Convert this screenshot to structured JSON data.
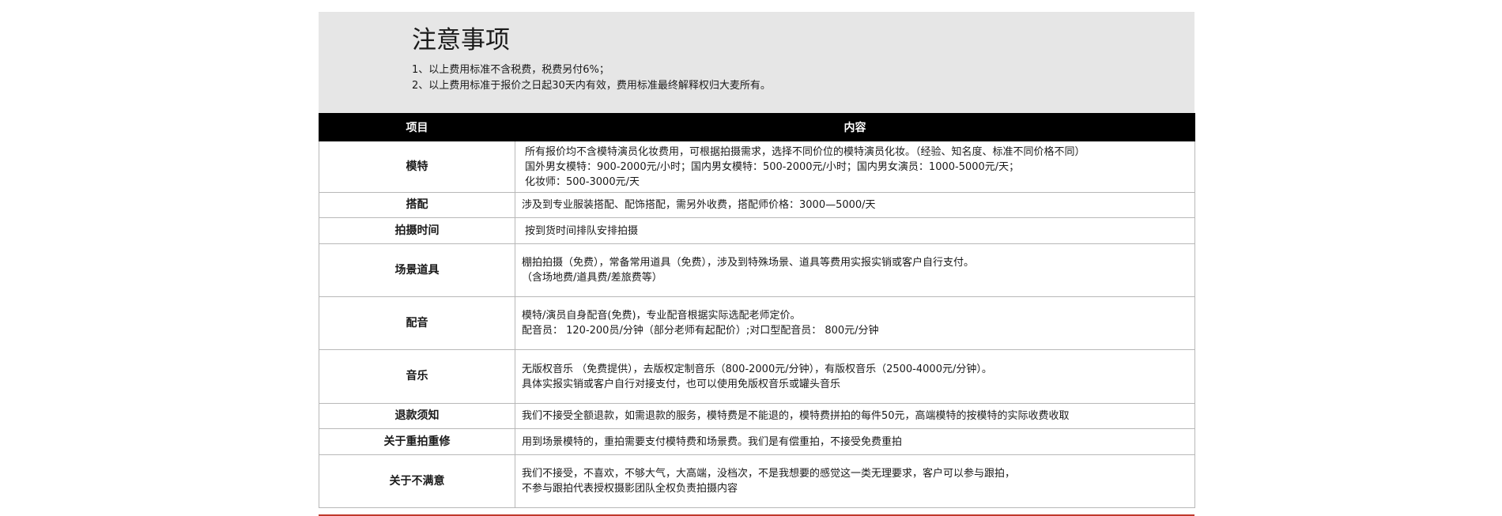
{
  "notice": {
    "title": "注意事项",
    "lines": [
      "1、以上费用标准不含税费，税费另付6%；",
      "2、以上费用标准于报价之日起30天内有效，费用标准最终解释权归大麦所有。"
    ]
  },
  "table": {
    "headers": [
      "项目",
      "内容"
    ],
    "rows": [
      {
        "item": "模特",
        "lines": [
          "所有报价均不含模特演员化妆费用，可根据拍摄需求，选择不同价位的模特演员化妆。（经验、知名度、标准不同价格不同）",
          "国外男女模特：900-2000元/小时；国内男女模特：500-2000元/小时；国内男女演员：1000-5000元/天；",
          "化妆师：500-3000元/天"
        ]
      },
      {
        "item": "搭配",
        "lines": [
          "涉及到专业服装搭配、配饰搭配，需另外收费，搭配师价格：3000—5000/天"
        ]
      },
      {
        "item": "拍摄时间",
        "lines": [
          "按到货时间排队安排拍摄"
        ]
      },
      {
        "item": "场景道具",
        "lines": [
          "棚拍拍摄（免费），常备常用道具（免费），涉及到特殊场景、道具等费用实报实销或客户自行支付。",
          "（含场地费/道具费/差旅费等）"
        ]
      },
      {
        "item": "配音",
        "lines": [
          "模特/演员自身配音(免费)，专业配音根据实际选配老师定价。",
          "配音员： 120-200员/分钟（部分老师有起配价）;对口型配音员： 800元/分钟"
        ]
      },
      {
        "item": "音乐",
        "lines": [
          "无版权音乐 （免费提供），去版权定制音乐（800-2000元/分钟），有版权音乐（2500-4000元/分钟）。",
          "具体实报实销或客户自行对接支付，也可以使用免版权音乐或罐头音乐"
        ]
      },
      {
        "item": "退款须知",
        "lines": [
          "我们不接受全额退款，如需退款的服务，模特费是不能退的，模特费拼拍的每件50元，高端模特的按模特的实际收费收取"
        ]
      },
      {
        "item": "关于重拍重修",
        "lines": [
          "用到场景模特的，重拍需要支付模特费和场景费。我们是有偿重拍，不接受免费重拍"
        ]
      },
      {
        "item": "关于不满意",
        "lines": [
          "我们不接受，不喜欢，不够大气，大高端，没档次，不是我想要的感觉这一类无理要求，客户可以参与跟拍，",
          "不参与跟拍代表授权摄影团队全权负责拍摄内容"
        ]
      }
    ]
  }
}
